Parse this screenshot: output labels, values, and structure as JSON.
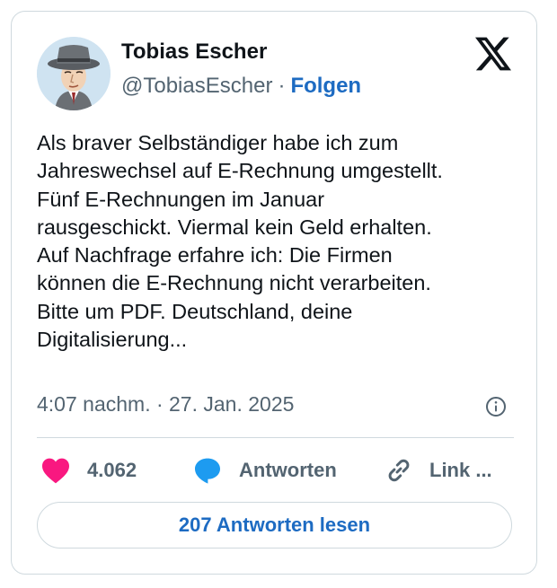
{
  "author": {
    "name": "Tobias Escher",
    "handle": "@TobiasEscher",
    "separator": "·",
    "follow_label": "Folgen"
  },
  "tweet": {
    "lines": [
      "Als braver Selbständiger habe ich zum",
      "Jahreswechsel auf E-Rechnung umgestellt.",
      "Fünf E-Rechnungen im Januar",
      "rausgeschickt. Viermal kein Geld erhalten.",
      "Auf Nachfrage erfahre ich: Die Firmen",
      "können die E-Rechnung nicht verarbeiten.",
      "Bitte um PDF. Deutschland, deine",
      "Digitalisierung..."
    ],
    "timestamp": "4:07 nachm. · 27. Jan. 2025"
  },
  "actions": {
    "like_count": "4.062",
    "reply_label": "Antworten",
    "link_label": "Link ..."
  },
  "read_replies_label": "207 Antworten lesen",
  "icons": {
    "brand": "x-logo-icon",
    "info": "info-icon",
    "like": "heart-icon",
    "reply": "speech-bubble-icon",
    "link": "chain-link-icon"
  },
  "colors": {
    "accent": "#1d6bc2",
    "like": "#f91880",
    "reply": "#1d9bf0",
    "muted": "#536471",
    "text": "#0f1419",
    "border": "#cfd9de"
  }
}
